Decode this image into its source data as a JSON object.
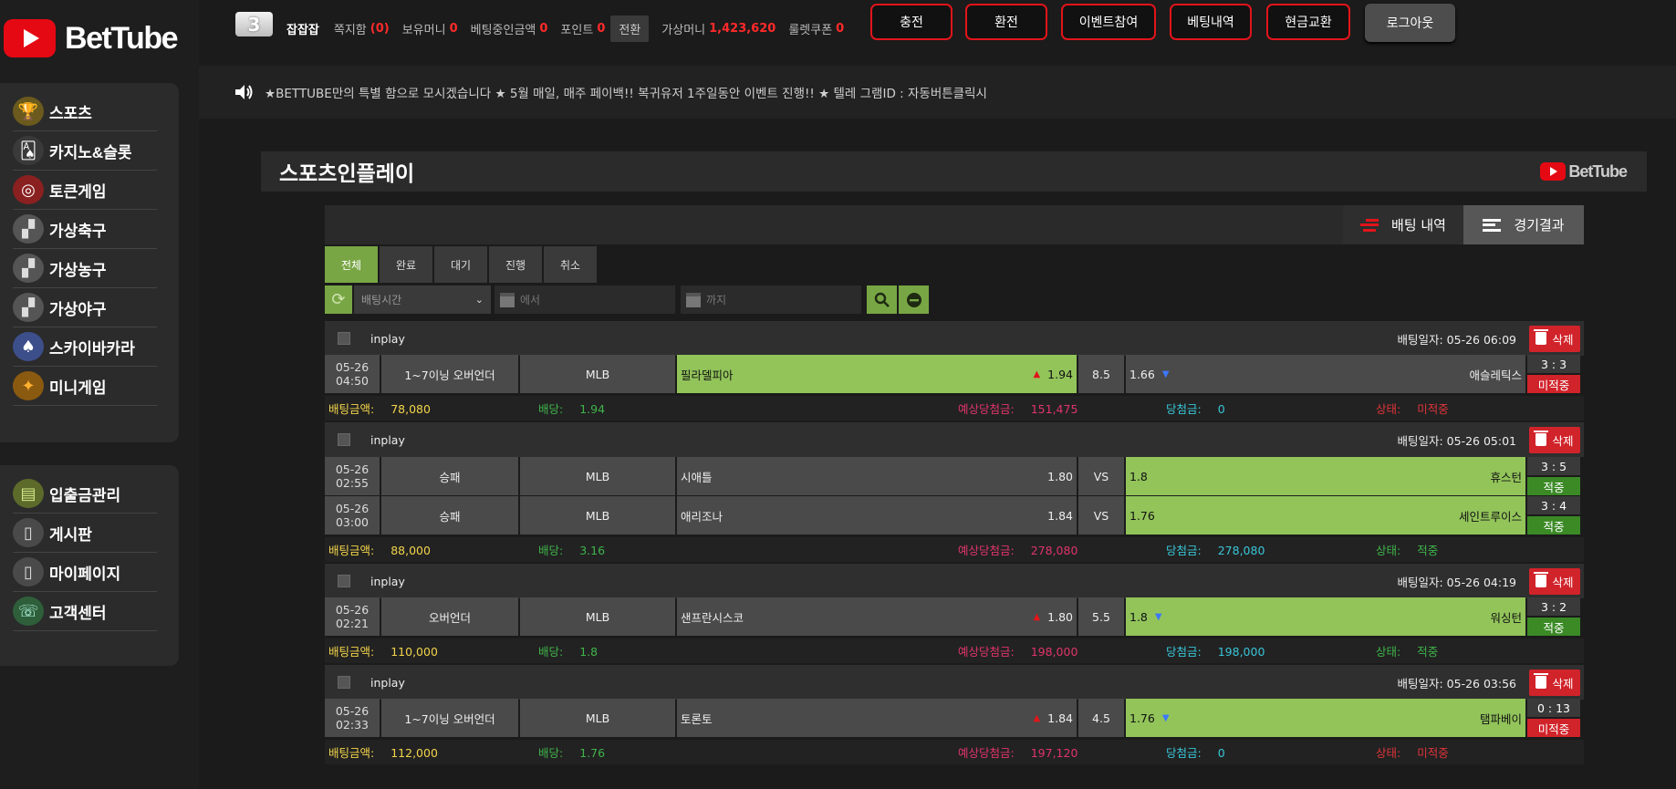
{
  "brand": {
    "name": "BetTube"
  },
  "sidebar": {
    "main_items": [
      {
        "label": "스포츠",
        "icon": "trophy-icon"
      },
      {
        "label": "카지노&슬롯",
        "icon": "casino-icon"
      },
      {
        "label": "토큰게임",
        "icon": "target-icon"
      },
      {
        "label": "가상축구",
        "icon": "virtual-soccer-icon"
      },
      {
        "label": "가상농구",
        "icon": "virtual-basketball-icon"
      },
      {
        "label": "가상야구",
        "icon": "virtual-baseball-icon"
      },
      {
        "label": "스카이바카라",
        "icon": "sky-baccarat-icon"
      },
      {
        "label": "미니게임",
        "icon": "minigame-icon"
      }
    ],
    "sub_items": [
      {
        "label": "입출금관리",
        "icon": "money-icon"
      },
      {
        "label": "게시판",
        "icon": "board-icon"
      },
      {
        "label": "마이페이지",
        "icon": "mypage-icon"
      },
      {
        "label": "고객센터",
        "icon": "support-icon"
      }
    ]
  },
  "header": {
    "level": "3",
    "username": "잡잡잡",
    "messages_label": "쪽지함",
    "messages_count": "(0)",
    "balance_label": "보유머니",
    "balance_value": "0",
    "betting_amount_label": "베팅중인금액",
    "betting_amount_value": "0",
    "points_label": "포인트",
    "points_value": "0",
    "convert_label": "전환",
    "virtual_money_label": "가상머니",
    "virtual_money_value": "1,423,620",
    "roulette_label": "룰렛쿠폰",
    "roulette_value": "0",
    "buttons": [
      "충전",
      "환전",
      "이벤트참여",
      "베팅내역",
      "현금교환"
    ],
    "logout_label": "로그아웃"
  },
  "notice": {
    "text": "★BETTUBE만의 특별 함으로 모시겠습니다 ★ 5월 매일, 매주 페이백!! 복귀유저 1주일동안 이벤트 진행!! ★ 텔레 그램ID : 자동버튼클릭시"
  },
  "page": {
    "title": "스포츠인플레이",
    "tab_bet_history": "배팅 내역",
    "tab_game_result": "경기결과",
    "filters": [
      "전체",
      "완료",
      "대기",
      "진행",
      "취소"
    ],
    "select_value": "배팅시간",
    "date_from_placeholder": "에서",
    "date_to_placeholder": "까지"
  },
  "footer_labels": {
    "amount": "배팅금액:",
    "odds": "배당:",
    "expected": "예상당첨금:",
    "win": "당첨금:",
    "status": "상태:"
  },
  "slips": [
    {
      "tag": "inplay",
      "bet_date": "배팅일자: 05-26 06:09",
      "delete_label": "삭제",
      "games": [
        {
          "date": "05-26",
          "time": "04:50",
          "type": "1~7이닝 오버언더",
          "league": "MLB",
          "home": "필라델피아",
          "home_odds": "1.94",
          "mid": "8.5",
          "away": "애슬레틱스",
          "away_odds": "1.66",
          "score": "3 : 3",
          "status": "미적중"
        }
      ],
      "amount": "78,080",
      "odds": "1.94",
      "expected": "151,475",
      "win": "0",
      "status": "미적중"
    },
    {
      "tag": "inplay",
      "bet_date": "배팅일자: 05-26 05:01",
      "delete_label": "삭제",
      "games": [
        {
          "date": "05-26",
          "time": "02:55",
          "type": "승패",
          "league": "MLB",
          "home": "시애틀",
          "home_odds": "1.80",
          "mid": "VS",
          "away": "휴스턴",
          "away_odds": "1.8",
          "score": "3 : 5",
          "status": "적중"
        },
        {
          "date": "05-26",
          "time": "03:00",
          "type": "승패",
          "league": "MLB",
          "home": "애리조나",
          "home_odds": "1.84",
          "mid": "VS",
          "away": "세인트루이스",
          "away_odds": "1.76",
          "score": "3 : 4",
          "status": "적중"
        }
      ],
      "amount": "88,000",
      "odds": "3.16",
      "expected": "278,080",
      "win": "278,080",
      "status": "적중"
    },
    {
      "tag": "inplay",
      "bet_date": "배팅일자: 05-26 04:19",
      "delete_label": "삭제",
      "games": [
        {
          "date": "05-26",
          "time": "02:21",
          "type": "오버언더",
          "league": "MLB",
          "home": "샌프란시스코",
          "home_odds": "1.80",
          "mid": "5.5",
          "away": "워싱턴",
          "away_odds": "1.8",
          "score": "3 : 2",
          "status": "적중"
        }
      ],
      "amount": "110,000",
      "odds": "1.8",
      "expected": "198,000",
      "win": "198,000",
      "status": "적중"
    },
    {
      "tag": "inplay",
      "bet_date": "배팅일자: 05-26 03:56",
      "delete_label": "삭제",
      "games": [
        {
          "date": "05-26",
          "time": "02:33",
          "type": "1~7이닝 오버언더",
          "league": "MLB",
          "home": "토론토",
          "home_odds": "1.84",
          "mid": "4.5",
          "away": "탬파베이",
          "away_odds": "1.76",
          "score": "0 : 13",
          "status": "미적중"
        }
      ],
      "amount": "112,000",
      "odds": "1.76",
      "expected": "197,120",
      "win": "0",
      "status": "미적중"
    }
  ]
}
